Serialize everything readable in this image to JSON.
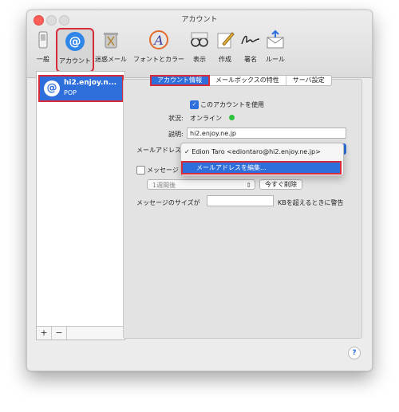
{
  "window": {
    "title": "アカウント"
  },
  "toolbar": {
    "items": [
      {
        "label": "一般",
        "icon": "switch-icon"
      },
      {
        "label": "アカウント",
        "icon": "at-icon"
      },
      {
        "label": "迷惑メール",
        "icon": "trash-icon"
      },
      {
        "label": "フォントとカラー",
        "icon": "font-icon"
      },
      {
        "label": "表示",
        "icon": "glasses-icon"
      },
      {
        "label": "作成",
        "icon": "compose-icon"
      },
      {
        "label": "署名",
        "icon": "signature-icon"
      },
      {
        "label": "ルール",
        "icon": "rules-icon"
      }
    ]
  },
  "sidebar": {
    "account": {
      "name": "hi2.enjoy.n...",
      "type": "POP"
    },
    "add_label": "+",
    "remove_label": "−"
  },
  "tabs": [
    "アカウント情報",
    "メールボックスの特性",
    "サーバ設定"
  ],
  "form": {
    "enable_label": "このアカウントを使用",
    "status_label": "状況:",
    "status_value": "オンライン",
    "description_label": "説明:",
    "description_value": "hi2.enjoy.ne.jp",
    "email_label": "メールアドレス",
    "delete_label": "メッセージ",
    "delete_period": "1週間後",
    "delete_now_label": "今すぐ削除",
    "size_label": "メッセージのサイズが",
    "size_suffix": "KBを超えるときに警告",
    "size_value": ""
  },
  "menu": {
    "checked_mark": "✓",
    "item_selected": "Edion Taro <ediontaro@hi2.enjoy.ne.jp>",
    "item_edit": "メールアドレスを編集..."
  },
  "help_label": "?"
}
